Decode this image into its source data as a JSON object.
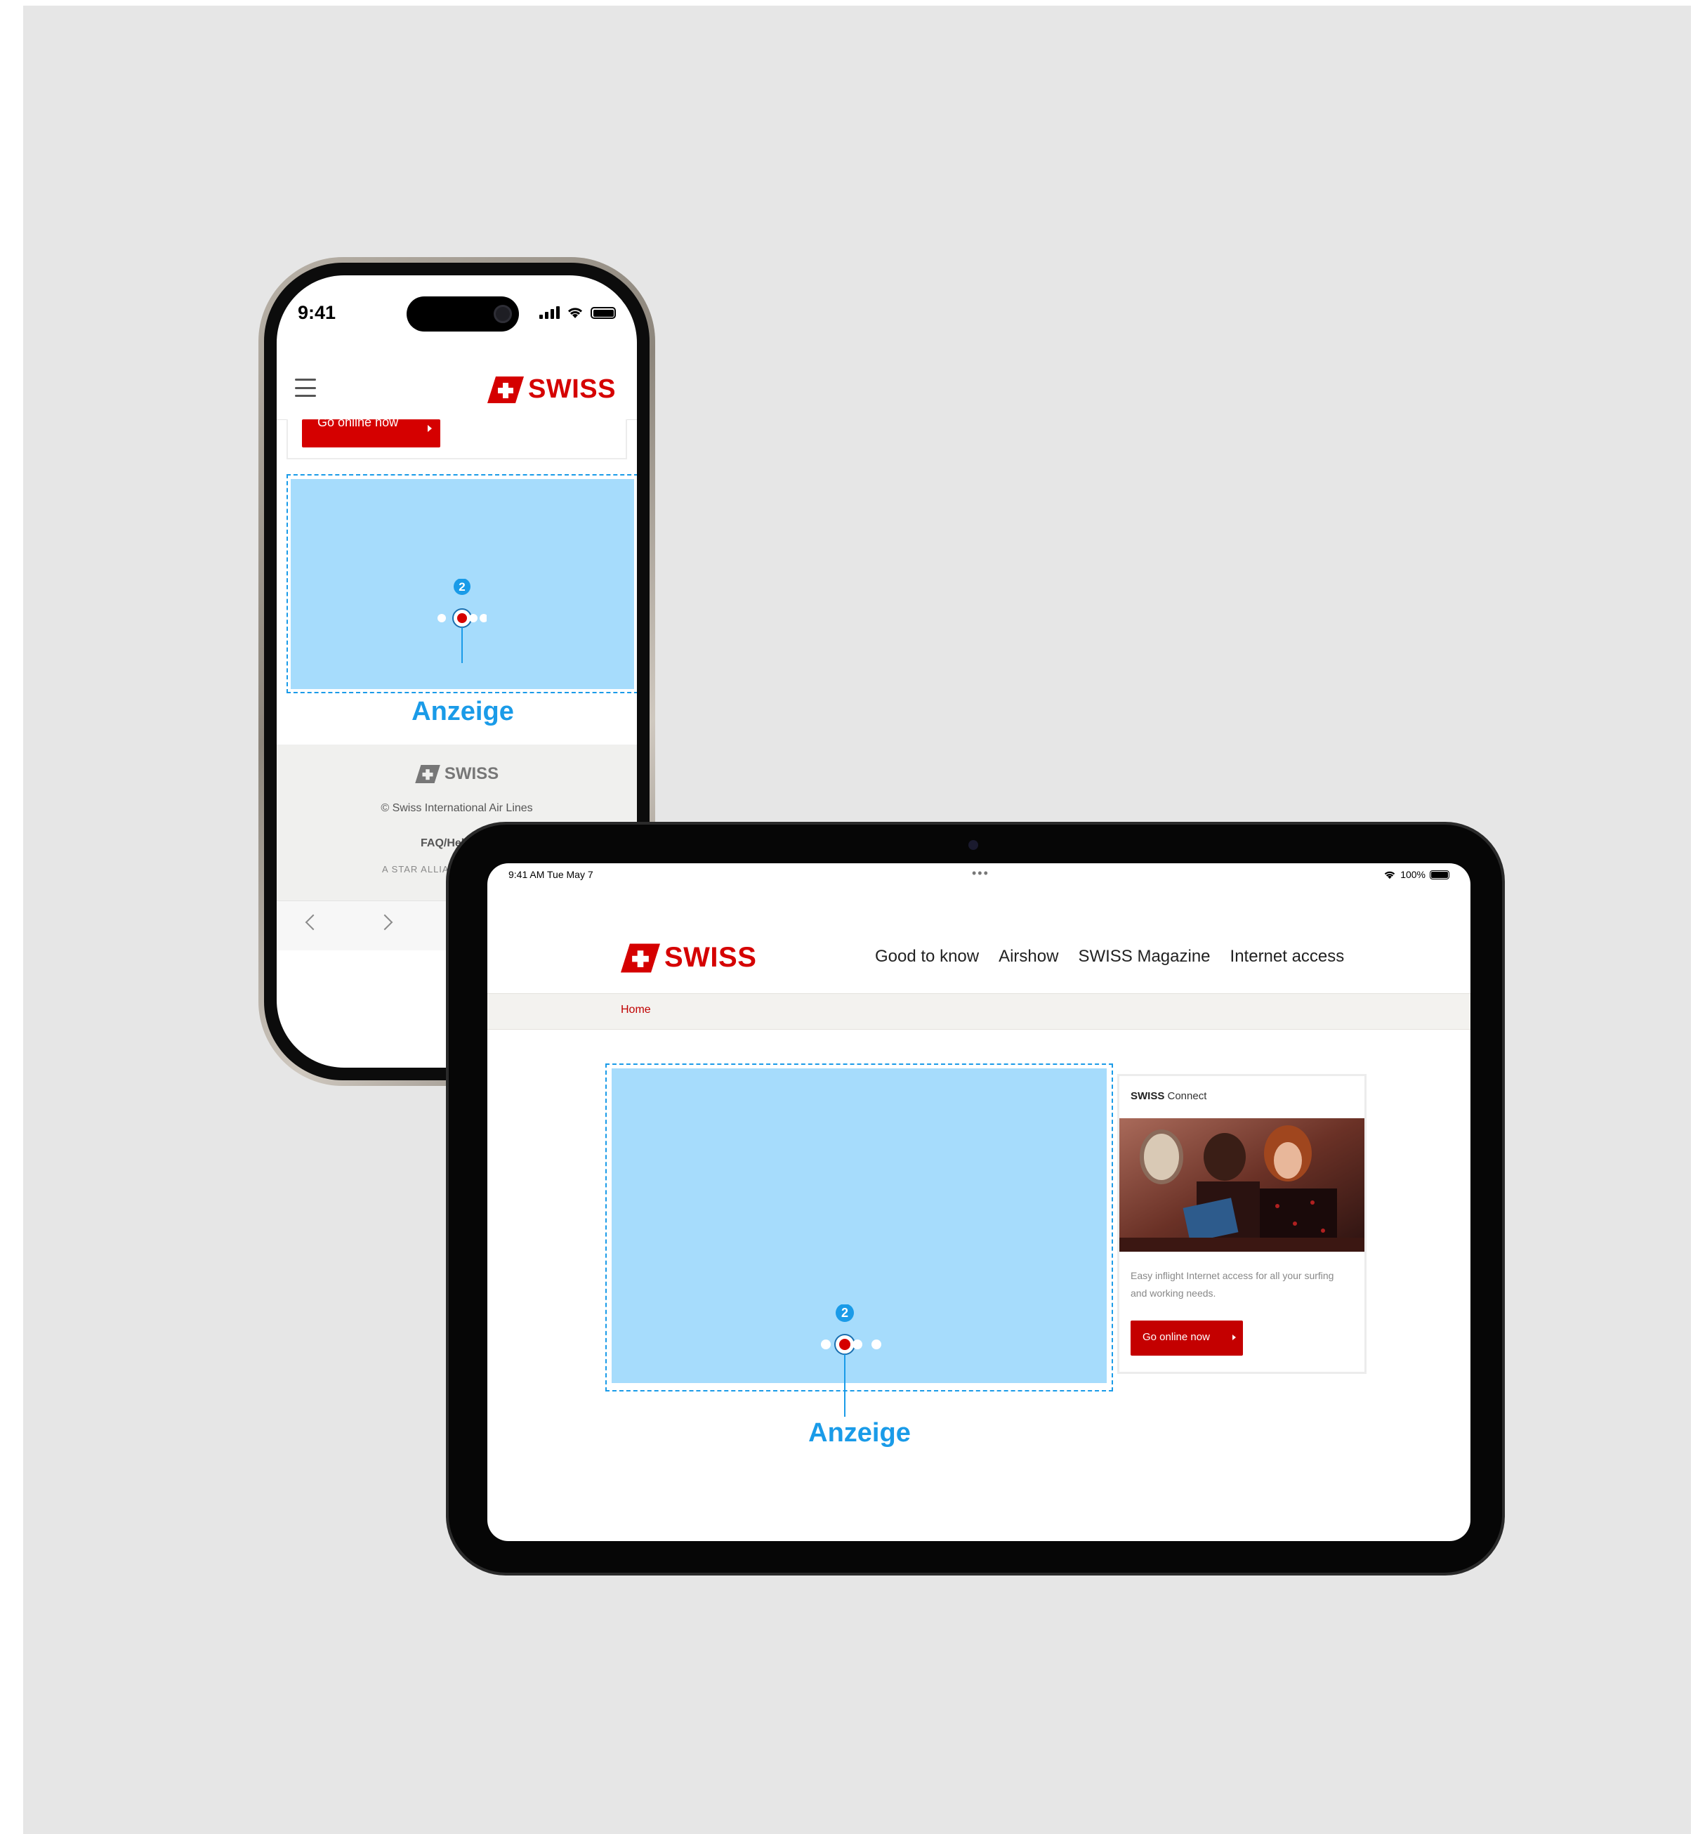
{
  "phone": {
    "status_time": "9:41",
    "header": {
      "menu_icon": "hamburger-icon",
      "logo_text": "SWISS"
    },
    "cta_label": "Go online now",
    "ad": {
      "badge": "2",
      "label": "Anzeige",
      "slides": 4,
      "active_slide": 2
    },
    "footer": {
      "logo_text": "SWISS",
      "copyright": "© Swiss International Air Lines",
      "faq_link": "FAQ/Help",
      "alliance_text": "A STAR ALLIAN"
    }
  },
  "tablet": {
    "status_time": "9:41 AM  Tue May 7",
    "status_dots": "•••",
    "battery": "100%",
    "logo_text": "SWISS",
    "nav": [
      "Good to know",
      "Airshow",
      "SWISS Magazine",
      "Internet access"
    ],
    "breadcrumb": "Home",
    "ad": {
      "badge": "2",
      "label": "Anzeige",
      "slides": 4,
      "active_slide": 2
    },
    "card": {
      "title_bold": "SWISS",
      "title_rest": " Connect",
      "description": "Easy inflight Internet access for all your surfing and working needs.",
      "button_label": "Go online now"
    }
  },
  "colors": {
    "brand_red": "#d50000",
    "annotation_blue": "#1a9be8",
    "ad_placeholder": "#a6dcfc",
    "background": "#e6e6e6"
  }
}
